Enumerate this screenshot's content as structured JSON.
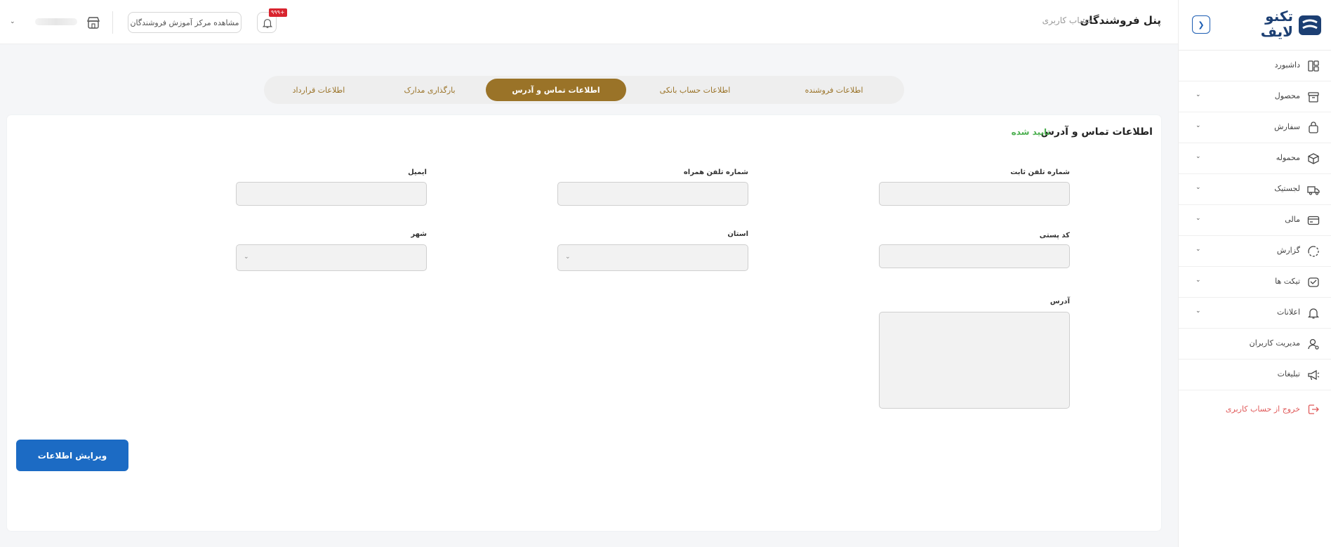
{
  "brand": {
    "logo_text_line1": "تکنو",
    "logo_text_line2": "لایف",
    "primary_color": "#1c3f73",
    "accent_color": "#9a7328",
    "button_color": "#1c6bc4"
  },
  "header": {
    "panel_title": "پنل فروشندگان",
    "breadcrumb": "حساب کاربری",
    "academy_button": "مشاهده مرکز آموزش فروشندگان",
    "notification_badge": "+۹۹۹"
  },
  "sidebar": {
    "items": [
      {
        "label": "داشبورد",
        "icon": "dashboard-icon",
        "has_submenu": false
      },
      {
        "label": "محصول",
        "icon": "product-icon",
        "has_submenu": true
      },
      {
        "label": "سفارش",
        "icon": "order-bag-icon",
        "has_submenu": true
      },
      {
        "label": "محموله",
        "icon": "package-icon",
        "has_submenu": true
      },
      {
        "label": "لجستیک",
        "icon": "truck-icon",
        "has_submenu": true
      },
      {
        "label": "مالی",
        "icon": "card-icon",
        "has_submenu": true
      },
      {
        "label": "گزارش",
        "icon": "report-icon",
        "has_submenu": true
      },
      {
        "label": "تیکت ها",
        "icon": "ticket-icon",
        "has_submenu": true
      },
      {
        "label": "اعلانات",
        "icon": "bell-icon",
        "has_submenu": true
      },
      {
        "label": "مدیریت کاربران",
        "icon": "user-manage-icon",
        "has_submenu": false
      },
      {
        "label": "تبلیغات",
        "icon": "megaphone-icon",
        "has_submenu": false
      }
    ],
    "logout": {
      "label": "خروج از حساب کاربری",
      "icon": "logout-icon"
    }
  },
  "tabs": [
    {
      "label": "اطلاعات فروشنده",
      "active": false
    },
    {
      "label": "اطلاعات حساب بانکی",
      "active": false
    },
    {
      "label": "اطلاعات تماس و آدرس",
      "active": true
    },
    {
      "label": "بارگذاری مدارک",
      "active": false
    },
    {
      "label": "اطلاعات قرارداد",
      "active": false
    }
  ],
  "form": {
    "title": "اطلاعات تماس و آدرس",
    "status": "تایید شده",
    "status_color": "#4caf50",
    "fields": {
      "landline_label": "شماره تلفن ثابت",
      "mobile_label": "شماره تلفن همراه",
      "email_label": "ایمیل",
      "postal_code_label": "کد پستی",
      "province_label": "استان",
      "city_label": "شهر",
      "address_label": "آدرس"
    },
    "edit_button": "ویرایش اطلاعات"
  }
}
